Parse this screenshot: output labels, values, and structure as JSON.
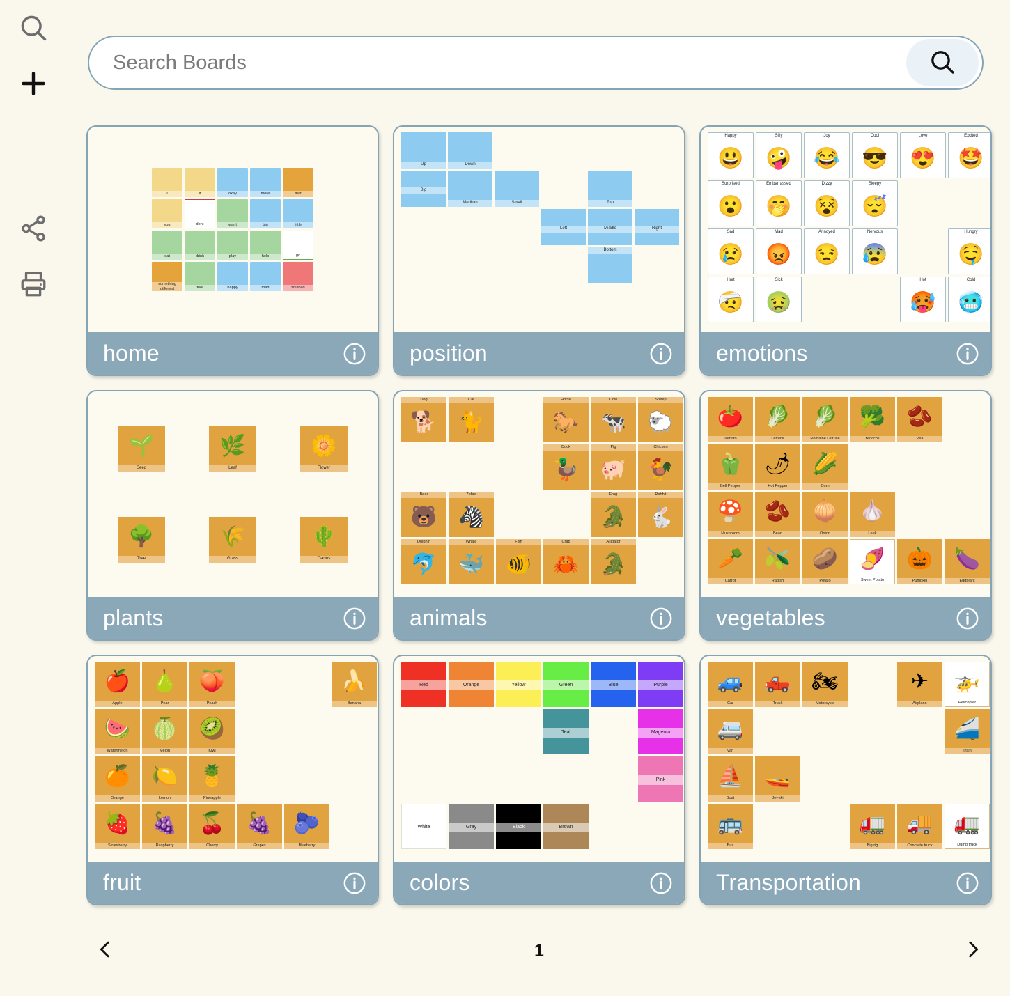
{
  "sidebar": {
    "items": [
      {
        "name": "search-icon",
        "label": "Search"
      },
      {
        "name": "add-icon",
        "label": "Add"
      },
      {
        "name": "share-icon",
        "label": "Share"
      },
      {
        "name": "print-icon",
        "label": "Print"
      }
    ]
  },
  "search": {
    "placeholder": "Search Boards",
    "value": "",
    "button_icon": "search-icon"
  },
  "boards": [
    {
      "title": "home",
      "info_icon": "info-icon",
      "layout": "home",
      "cells": [
        {
          "label": "I",
          "bg": "b-yellow"
        },
        {
          "label": "it",
          "bg": "b-yellow"
        },
        {
          "label": "okay",
          "bg": "b-blue"
        },
        {
          "label": "more",
          "bg": "b-blue"
        },
        {
          "label": "that",
          "bg": "b-orange"
        },
        {
          "label": "you",
          "bg": "b-yellow"
        },
        {
          "label": "dont",
          "bg": "b-dont"
        },
        {
          "label": "want",
          "bg": "b-green"
        },
        {
          "label": "big",
          "bg": "b-blue"
        },
        {
          "label": "little",
          "bg": "b-blue"
        },
        {
          "label": "eat",
          "bg": "b-green"
        },
        {
          "label": "drink",
          "bg": "b-green"
        },
        {
          "label": "play",
          "bg": "b-green"
        },
        {
          "label": "help",
          "bg": "b-green"
        },
        {
          "label": "go",
          "bg": "b-white"
        },
        {
          "label": "something different",
          "bg": "b-orange"
        },
        {
          "label": "feel",
          "bg": "b-green"
        },
        {
          "label": "happy",
          "bg": "b-blue"
        },
        {
          "label": "mad",
          "bg": "b-blue"
        },
        {
          "label": "finished",
          "bg": "b-red"
        }
      ]
    },
    {
      "title": "position",
      "info_icon": "info-icon",
      "layout": "position",
      "cells": [
        {
          "label": "Up",
          "col": 1,
          "row": 1
        },
        {
          "label": "Down",
          "col": 2,
          "row": 1
        },
        {
          "label": "Big",
          "col": 1,
          "row": 2
        },
        {
          "label": "Medium",
          "col": 2,
          "row": 2
        },
        {
          "label": "Small",
          "col": 3,
          "row": 2
        },
        {
          "label": "Top",
          "col": 5,
          "row": 2
        },
        {
          "label": "Left",
          "col": 4,
          "row": 3
        },
        {
          "label": "Middle",
          "col": 5,
          "row": 3
        },
        {
          "label": "Right",
          "col": 6,
          "row": 3
        },
        {
          "label": "Bottom",
          "col": 5,
          "row": 4
        }
      ]
    },
    {
      "title": "emotions",
      "info_icon": "info-icon",
      "layout": "emotions",
      "cells": [
        {
          "label": "Happy",
          "emoji": "😃",
          "col": 1,
          "row": 1
        },
        {
          "label": "Silly",
          "emoji": "🤪",
          "col": 2,
          "row": 1
        },
        {
          "label": "Joy",
          "emoji": "😂",
          "col": 3,
          "row": 1
        },
        {
          "label": "Cool",
          "emoji": "😎",
          "col": 4,
          "row": 1
        },
        {
          "label": "Love",
          "emoji": "😍",
          "col": 5,
          "row": 1
        },
        {
          "label": "Excited",
          "emoji": "🤩",
          "col": 6,
          "row": 1
        },
        {
          "label": "Surprised",
          "emoji": "😮",
          "col": 1,
          "row": 2
        },
        {
          "label": "Embarrassed",
          "emoji": "🤭",
          "col": 2,
          "row": 2
        },
        {
          "label": "Dizzy",
          "emoji": "😵",
          "col": 3,
          "row": 2
        },
        {
          "label": "Sleepy",
          "emoji": "😴",
          "col": 4,
          "row": 2
        },
        {
          "label": "Sad",
          "emoji": "😢",
          "col": 1,
          "row": 3
        },
        {
          "label": "Mad",
          "emoji": "😡",
          "col": 2,
          "row": 3
        },
        {
          "label": "Annoyed",
          "emoji": "😒",
          "col": 3,
          "row": 3
        },
        {
          "label": "Nervous",
          "emoji": "😰",
          "col": 4,
          "row": 3
        },
        {
          "label": "Hungry",
          "emoji": "🤤",
          "col": 6,
          "row": 3
        },
        {
          "label": "Hurt",
          "emoji": "🤕",
          "col": 1,
          "row": 4
        },
        {
          "label": "Sick",
          "emoji": "🤢",
          "col": 2,
          "row": 4
        },
        {
          "label": "Hot",
          "emoji": "🥵",
          "col": 5,
          "row": 4
        },
        {
          "label": "Cold",
          "emoji": "🥶",
          "col": 6,
          "row": 4
        }
      ]
    },
    {
      "title": "plants",
      "info_icon": "info-icon",
      "layout": "plants",
      "cells": [
        {
          "label": "Seed",
          "emoji": "🌱"
        },
        {
          "label": "Leaf",
          "emoji": "🌿"
        },
        {
          "label": "Flower",
          "emoji": "🌼"
        },
        {
          "label": "Tree",
          "emoji": "🌳"
        },
        {
          "label": "Grass",
          "emoji": "🌾"
        },
        {
          "label": "Cactus",
          "emoji": "🌵"
        }
      ]
    },
    {
      "title": "animals",
      "info_icon": "info-icon",
      "layout": "tan",
      "label_pos": "top",
      "cells": [
        {
          "label": "Dog",
          "emoji": "🐕",
          "col": 1,
          "row": 1
        },
        {
          "label": "Cat",
          "emoji": "🐈",
          "col": 2,
          "row": 1
        },
        {
          "label": "Horse",
          "emoji": "🐎",
          "col": 4,
          "row": 1
        },
        {
          "label": "Cow",
          "emoji": "🐄",
          "col": 5,
          "row": 1
        },
        {
          "label": "Sheep",
          "emoji": "🐑",
          "col": 6,
          "row": 1
        },
        {
          "label": "Duck",
          "emoji": "🦆",
          "col": 4,
          "row": 2
        },
        {
          "label": "Pig",
          "emoji": "🐖",
          "col": 5,
          "row": 2
        },
        {
          "label": "Chicken",
          "emoji": "🐓",
          "col": 6,
          "row": 2
        },
        {
          "label": "Bear",
          "emoji": "🐻",
          "col": 1,
          "row": 3
        },
        {
          "label": "Zebra",
          "emoji": "🦓",
          "col": 2,
          "row": 3
        },
        {
          "label": "Frog",
          "emoji": "🐊",
          "col": 5,
          "row": 3
        },
        {
          "label": "Rabbit",
          "emoji": "🐇",
          "col": 6,
          "row": 3
        },
        {
          "label": "Dolphin",
          "emoji": "🐬",
          "col": 1,
          "row": 4
        },
        {
          "label": "Whale",
          "emoji": "🐳",
          "col": 2,
          "row": 4
        },
        {
          "label": "Fish",
          "emoji": "🐠",
          "col": 3,
          "row": 4
        },
        {
          "label": "Crab",
          "emoji": "🦀",
          "col": 4,
          "row": 4
        },
        {
          "label": "Alligator",
          "emoji": "🐊",
          "col": 5,
          "row": 4
        }
      ]
    },
    {
      "title": "vegetables",
      "info_icon": "info-icon",
      "layout": "tan",
      "label_pos": "bottom",
      "cells": [
        {
          "label": "Tomato",
          "emoji": "🍅",
          "col": 1,
          "row": 1
        },
        {
          "label": "Lettuce",
          "emoji": "🥬",
          "col": 2,
          "row": 1
        },
        {
          "label": "Romaine Lettuce",
          "emoji": "🥬",
          "col": 3,
          "row": 1
        },
        {
          "label": "Broccoli",
          "emoji": "🥦",
          "col": 4,
          "row": 1
        },
        {
          "label": "Pea",
          "emoji": "🫘",
          "col": 5,
          "row": 1
        },
        {
          "label": "Bell Pepper",
          "emoji": "🫑",
          "col": 1,
          "row": 2
        },
        {
          "label": "Hot Pepper",
          "emoji": "🌶",
          "col": 2,
          "row": 2
        },
        {
          "label": "Corn",
          "emoji": "🌽",
          "col": 3,
          "row": 2
        },
        {
          "label": "Mushroom",
          "emoji": "🍄",
          "col": 1,
          "row": 3
        },
        {
          "label": "Bean",
          "emoji": "🫘",
          "col": 2,
          "row": 3
        },
        {
          "label": "Onion",
          "emoji": "🧅",
          "col": 3,
          "row": 3
        },
        {
          "label": "Leek",
          "emoji": "🧄",
          "col": 4,
          "row": 3
        },
        {
          "label": "Carrot",
          "emoji": "🥕",
          "col": 1,
          "row": 4
        },
        {
          "label": "Radish",
          "emoji": "🫒",
          "col": 2,
          "row": 4
        },
        {
          "label": "Potato",
          "emoji": "🥔",
          "col": 3,
          "row": 4
        },
        {
          "label": "Sweet Potato",
          "emoji": "🍠",
          "col": 4,
          "row": 4,
          "white": true
        },
        {
          "label": "Pumpkin",
          "emoji": "🎃",
          "col": 5,
          "row": 4
        },
        {
          "label": "Eggplant",
          "emoji": "🍆",
          "col": 6,
          "row": 4
        }
      ]
    },
    {
      "title": "fruit",
      "info_icon": "info-icon",
      "layout": "tan",
      "label_pos": "bottom",
      "cells": [
        {
          "label": "Apple",
          "emoji": "🍎",
          "col": 1,
          "row": 1
        },
        {
          "label": "Pear",
          "emoji": "🍐",
          "col": 2,
          "row": 1
        },
        {
          "label": "Peach",
          "emoji": "🍑",
          "col": 3,
          "row": 1
        },
        {
          "label": "Banana",
          "emoji": "🍌",
          "col": 6,
          "row": 1
        },
        {
          "label": "Watermelon",
          "emoji": "🍉",
          "col": 1,
          "row": 2
        },
        {
          "label": "Melon",
          "emoji": "🍈",
          "col": 2,
          "row": 2
        },
        {
          "label": "Kiwi",
          "emoji": "🥝",
          "col": 3,
          "row": 2
        },
        {
          "label": "Orange",
          "emoji": "🍊",
          "col": 1,
          "row": 3
        },
        {
          "label": "Lemon",
          "emoji": "🍋",
          "col": 2,
          "row": 3
        },
        {
          "label": "Pineapple",
          "emoji": "🍍",
          "col": 3,
          "row": 3
        },
        {
          "label": "Strawberry",
          "emoji": "🍓",
          "col": 1,
          "row": 4
        },
        {
          "label": "Raspberry",
          "emoji": "🍇",
          "col": 2,
          "row": 4
        },
        {
          "label": "Cherry",
          "emoji": "🍒",
          "col": 3,
          "row": 4
        },
        {
          "label": "Grapes",
          "emoji": "🍇",
          "col": 4,
          "row": 4
        },
        {
          "label": "Blueberry",
          "emoji": "🫐",
          "col": 5,
          "row": 4
        }
      ]
    },
    {
      "title": "colors",
      "info_icon": "info-icon",
      "layout": "colors",
      "cells": [
        {
          "label": "Red",
          "color": "#ee3124",
          "col": 1,
          "row": 1
        },
        {
          "label": "Orange",
          "color": "#ef8434",
          "col": 2,
          "row": 1
        },
        {
          "label": "Yellow",
          "color": "#fcee55",
          "col": 3,
          "row": 1
        },
        {
          "label": "Green",
          "color": "#68ed46",
          "col": 4,
          "row": 1
        },
        {
          "label": "Blue",
          "color": "#2563ef",
          "col": 5,
          "row": 1
        },
        {
          "label": "Purple",
          "color": "#7e3df5",
          "col": 6,
          "row": 1
        },
        {
          "label": "Teal",
          "color": "#46949b",
          "col": 4,
          "row": 2
        },
        {
          "label": "Magenta",
          "color": "#e731e9",
          "col": 6,
          "row": 2
        },
        {
          "label": "Pink",
          "color": "#ee76b5",
          "col": 6,
          "row": 3
        },
        {
          "label": "White",
          "color": "#ffffff",
          "col": 1,
          "row": 4
        },
        {
          "label": "Gray",
          "color": "#8a8a8a",
          "col": 2,
          "row": 4
        },
        {
          "label": "Black",
          "color": "#000000",
          "col": 3,
          "row": 4
        },
        {
          "label": "Brown",
          "color": "#ad8757",
          "col": 4,
          "row": 4
        }
      ]
    },
    {
      "title": "Transportation",
      "info_icon": "info-icon",
      "layout": "tan",
      "label_pos": "bottom",
      "cells": [
        {
          "label": "Car",
          "emoji": "🚙",
          "col": 1,
          "row": 1
        },
        {
          "label": "Truck",
          "emoji": "🛻",
          "col": 2,
          "row": 1
        },
        {
          "label": "Motorcycle",
          "emoji": "🏍",
          "col": 3,
          "row": 1
        },
        {
          "label": "Airplane",
          "emoji": "✈",
          "col": 5,
          "row": 1
        },
        {
          "label": "Helicopter",
          "emoji": "🚁",
          "col": 6,
          "row": 1,
          "white": true
        },
        {
          "label": "Van",
          "emoji": "🚐",
          "col": 1,
          "row": 2
        },
        {
          "label": "Train",
          "emoji": "🚄",
          "col": 6,
          "row": 2
        },
        {
          "label": "Boat",
          "emoji": "⛵",
          "col": 1,
          "row": 3
        },
        {
          "label": "Jet-ski",
          "emoji": "🚤",
          "col": 2,
          "row": 3
        },
        {
          "label": "Bus",
          "emoji": "🚌",
          "col": 1,
          "row": 4
        },
        {
          "label": "Big rig",
          "emoji": "🚛",
          "col": 4,
          "row": 4
        },
        {
          "label": "Concrete truck",
          "emoji": "🚚",
          "col": 5,
          "row": 4
        },
        {
          "label": "Dump truck",
          "emoji": "🚛",
          "col": 6,
          "row": 4,
          "white": true
        }
      ]
    }
  ],
  "pagination": {
    "prev_icon": "chevron-left-icon",
    "next_icon": "chevron-right-icon",
    "current_page": "1"
  }
}
